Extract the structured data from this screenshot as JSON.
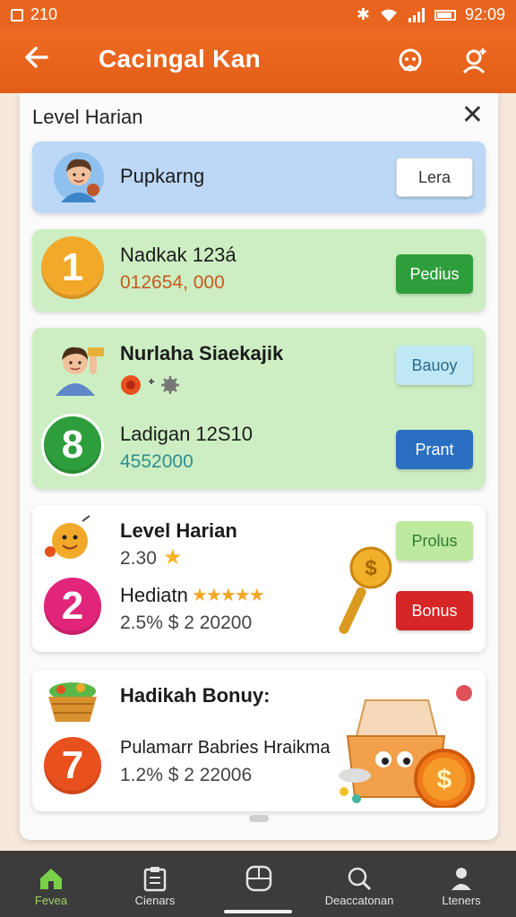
{
  "status": {
    "left": "210",
    "time": "92:09"
  },
  "appbar": {
    "title": "Cacingal Kan",
    "back_icon": "arrow-left-icon",
    "icons": [
      "bot-icon",
      "person-add-icon"
    ]
  },
  "sheet": {
    "title": "Level Harian",
    "close": "✕"
  },
  "cards": [
    {
      "name": "Pupkarng",
      "button": "Lera"
    },
    {
      "number": "1",
      "name": "Nadkak 123á",
      "value": "012654, 000",
      "button": "Pedius"
    },
    {
      "name": "Nurlaha Siaekajik",
      "button": "Bauoy",
      "sub_number": "8",
      "sub_name": "Ladigan 12S10",
      "sub_value": "4552000",
      "sub_button": "Prant"
    },
    {
      "name": "Level Harian",
      "value": "2.30",
      "number": "2",
      "sub_name": "Hediatn",
      "sub_value": "2.5%  $ 2 20200",
      "button": "Prolus",
      "sub_button": "Bonus"
    },
    {
      "name": "Hadikah Bonuy:",
      "number": "7",
      "sub_name": "Pulamarr Babries Hraikma",
      "sub_value": "1.2%  $ 2 22006"
    }
  ],
  "nav": [
    {
      "label": "Fevea",
      "icon": "home-icon"
    },
    {
      "label": "Cienars",
      "icon": "clipboard-icon"
    },
    {
      "label": "",
      "icon": "add-square-icon"
    },
    {
      "label": "Deaccatonan",
      "icon": "search-icon"
    },
    {
      "label": "Lteners",
      "icon": "person-icon"
    }
  ],
  "colors": {
    "primary": "#e8641f",
    "green_btn": "#2e9e3c",
    "blue_btn": "#2a6fc1",
    "red_btn": "#d62525",
    "orange_badge": "#f2a92a",
    "pink_badge": "#e0257b",
    "red_badge": "#e8501d"
  }
}
